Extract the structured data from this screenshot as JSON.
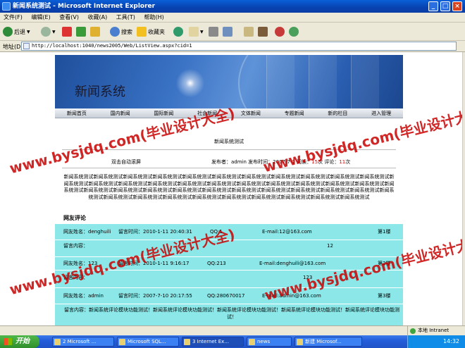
{
  "window": {
    "title": "新闻系统测试 - Microsoft Internet Explorer",
    "controls": [
      "_",
      "□",
      "×"
    ]
  },
  "menu": [
    "文件(F)",
    "编辑(E)",
    "查看(V)",
    "收藏(A)",
    "工具(T)",
    "帮助(H)"
  ],
  "toolbar": {
    "back": "后退",
    "search": "搜索",
    "favorites": "收藏夹"
  },
  "address": {
    "label": "地址(D)",
    "url": "http://localhost:1040/news2005/Web/ListView.aspx?cid=1"
  },
  "site": {
    "title": "新闻系统",
    "nav": [
      "新闻首页",
      "国内新闻",
      "国际新闻",
      "社会新闻",
      "文体新闻",
      "专题新闻",
      "新的栏目",
      "进入管理"
    ]
  },
  "article": {
    "title": "新闻系统测试",
    "scroll_link": "双击自动滚屏",
    "meta_prefix": "发布者：admin 发布时间：2007-7-1 阅读：",
    "reads": "15",
    "meta_mid": "次 评论：",
    "comments_count": "11",
    "meta_suffix": "次",
    "body": "新闻系统测试新闻系统测试新闻系统测试新闻系统测试新闻系统测试新闻系统测试新闻系统测试新闻系统测试新闻系统测试新闻系统测试新闻系统测试新闻系统测试新闻系统测试新闻系统测试新闻系统测试新闻系统测试新闻系统测试新闻系统测试新闻系统测试新闻系统测试新闻系统测试新闻系统测试新闻系统测试新闻系统测试新闻系统测试新闻系统测试新闻系统测试新闻系统测试新闻系统测试新闻系统测试新闻系统测试新闻系统测试新闻系统测试新闻系统测试新闻系统测试新闻系统测试新闻系统测试新闻系统测试新闻系统测试新闻系统测试新闻系统测试新闻系统测试新闻系统测试"
  },
  "comments": {
    "heading": "网友评论",
    "items": [
      {
        "name": "网友姓名：denghuili",
        "time": "留言时间：2010-1-11 20:40:31",
        "qq": "QQ:1",
        "email": "E-mail:12@163.com",
        "floor": "第1楼",
        "content_label": "留言内容：",
        "content": "12"
      },
      {
        "name": "网友姓名：123",
        "time": "留言时间：2010-1-11 9:16:17",
        "qq": "QQ:213",
        "email": "E-mail:denghuili@163.com",
        "floor": "第2楼",
        "content_label": "留言内容：",
        "content": "123"
      },
      {
        "name": "网友姓名：admin",
        "time": "留言时间：2007-7-10 20:17:55",
        "qq": "QQ:280670017",
        "email": "E-mail:admin@163.com",
        "floor": "第3楼",
        "content_label": "留言内容：",
        "content": "新闻系统评论模块功能测试！新闻系统评论模块功能测试！新闻系统评论模块功能测试！新闻系统评论模块功能测试！新闻系统评论模块功能测试！"
      }
    ]
  },
  "watermark": "www.bysjdq.com(毕业设计大全)",
  "statusbar": {
    "zone": "本地 Intranet"
  },
  "taskbar": {
    "start": "开始",
    "tasks": [
      "2 Microsoft ...",
      "Microsoft SQL...",
      "3 Internet Ex...",
      "news",
      "新建 Microsof..."
    ],
    "clock": "14:32"
  }
}
